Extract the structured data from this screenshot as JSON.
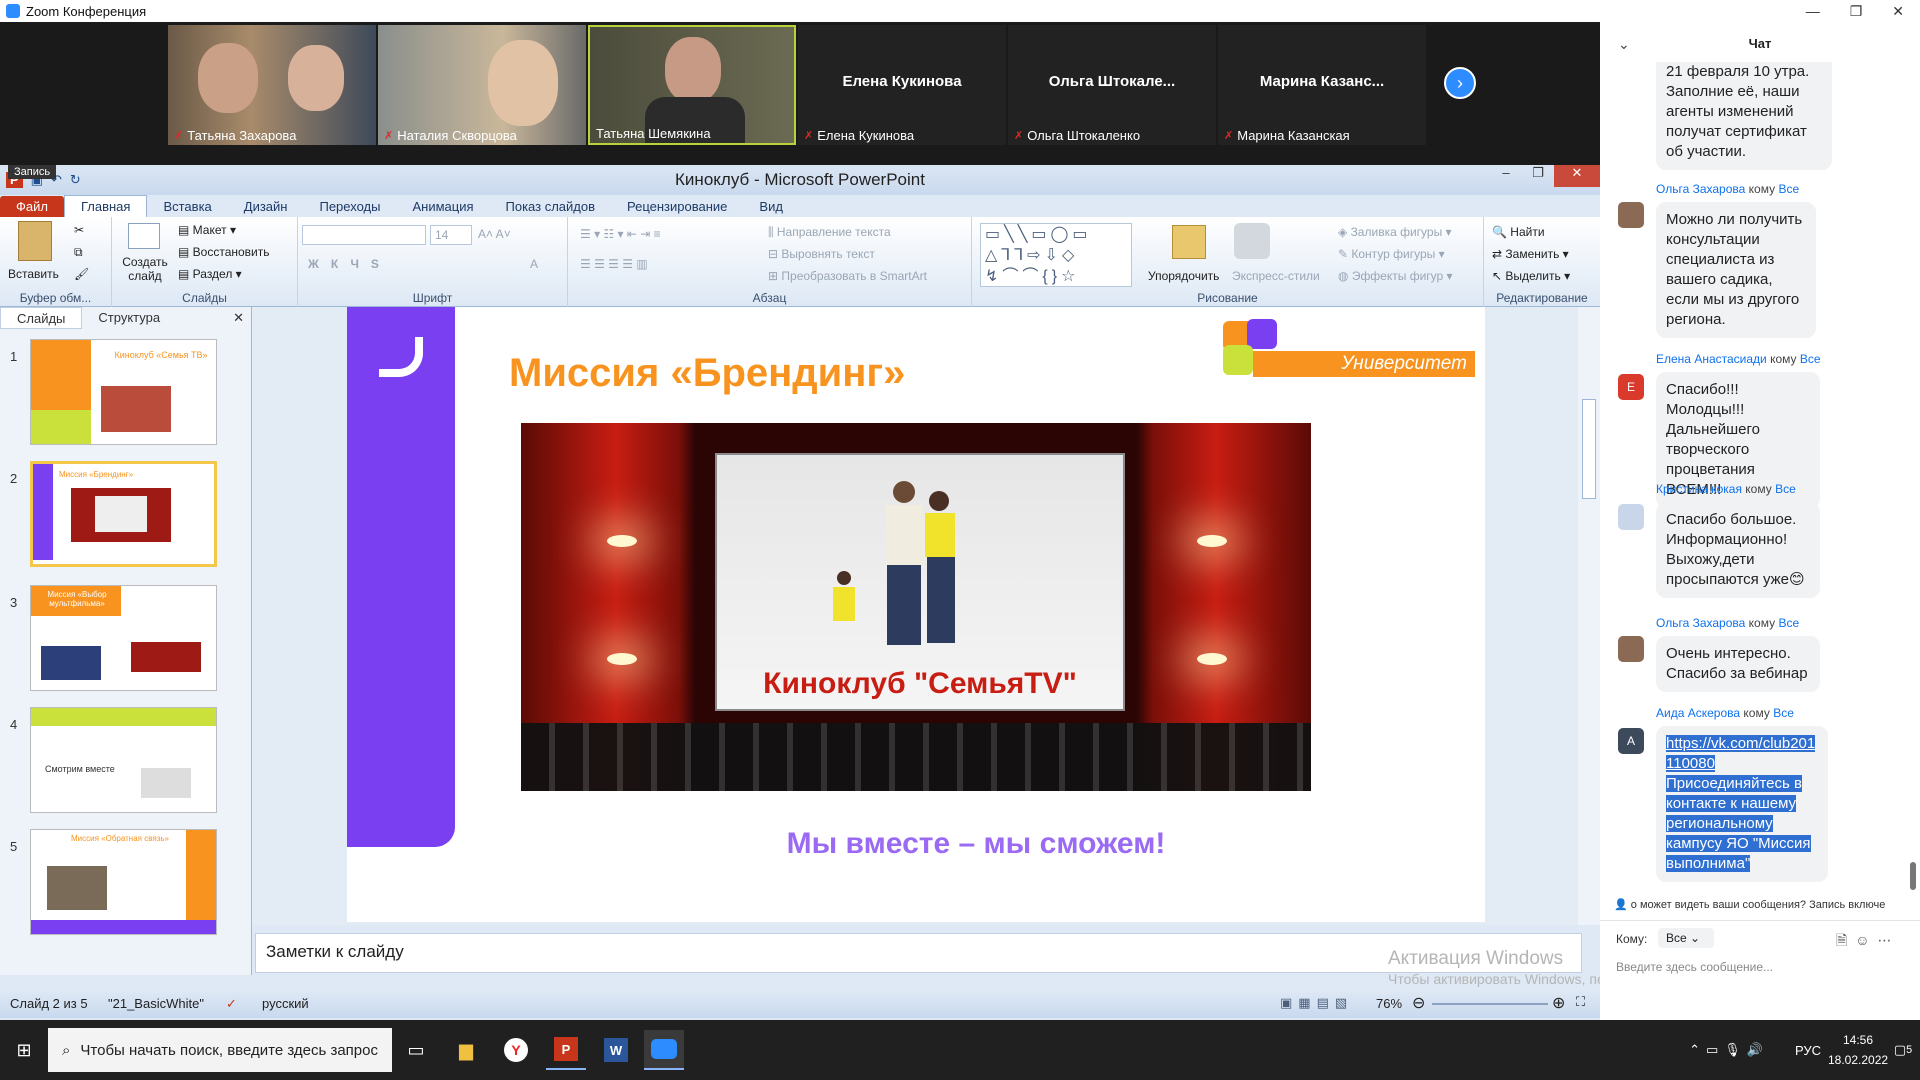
{
  "zoom": {
    "window_title": "Zoom Конференция",
    "win_min": "—",
    "win_max": "❐",
    "win_close": "✕",
    "participants": [
      {
        "name": "Татьяна Захарова",
        "video": true
      },
      {
        "name": "Наталия Скворцова",
        "video": true
      },
      {
        "name": "Татьяна Шемякина",
        "video": true
      },
      {
        "name": "Елена Кукинова",
        "big": "Елена Кукинова",
        "video": false
      },
      {
        "name": "Ольга Штокаленко",
        "big": "Ольга  Штокале...",
        "video": false
      },
      {
        "name": "Марина Казанская",
        "big": "Марина  Казанс...",
        "video": false
      }
    ],
    "next_arrow": "›",
    "recording_label": "Запись"
  },
  "ppt": {
    "title": "Киноклуб  -  Microsoft PowerPoint",
    "tabs": [
      "Файл",
      "Главная",
      "Вставка",
      "Дизайн",
      "Переходы",
      "Анимация",
      "Показ слайдов",
      "Рецензирование",
      "Вид"
    ],
    "ribbon": {
      "paste": "Вставить",
      "create_slide": "Создать слайд",
      "layout": "Макет",
      "restore": "Восстановить",
      "section": "Раздел",
      "font_size": "14",
      "text_direction": "Направление текста",
      "align_text": "Выровнять текст",
      "smartart": "Преобразовать в SmartArt",
      "arrange": "Упорядочить",
      "express_styles": "Экспресс-стили",
      "shape_fill": "Заливка фигуры",
      "shape_outline": "Контур фигуры",
      "shape_effects": "Эффекты фигур",
      "find": "Найти",
      "replace": "Заменить",
      "select": "Выделить",
      "groups": [
        "Буфер обм...",
        "Слайды",
        "Шрифт",
        "Абзац",
        "Рисование",
        "Редактирование"
      ]
    },
    "pane_tabs": [
      "Слайды",
      "Структура"
    ],
    "thumbs": [
      {
        "n": "1",
        "title": "Киноклуб «Семья ТВ»"
      },
      {
        "n": "2",
        "title": "Миссия «Брендинг»"
      },
      {
        "n": "3",
        "title": "Миссия «Выбор мультфильма»"
      },
      {
        "n": "4",
        "title": "Смотрим вместе"
      },
      {
        "n": "5",
        "title": "Миссия «Обратная связь»"
      }
    ],
    "slide": {
      "title": "Миссия «Брендинг»",
      "brand": "Университет Детства",
      "club": "Киноклуб \"СемьяTV\"",
      "slogan": "Мы вместе – мы сможем!"
    },
    "notes_placeholder": "Заметки к слайду",
    "activation_title": "Активация Windows",
    "activation_text": "Чтобы активировать Windows, перейдите в раздел \"Параметры\".",
    "status": {
      "slide_of": "Слайд 2 из 5",
      "theme": "\"21_BasicWhite\"",
      "language": "русский",
      "zoom": "76%"
    }
  },
  "chat": {
    "title": "Чат",
    "top_bubble": "21 февраля 10 утра. Заполние её, наши агенты изменений получат сертификат об участии.",
    "messages": [
      {
        "sender": "Ольга Захарова",
        "to": "кому",
        "target": "Все",
        "text": "Можно ли получить консультации специалиста из вашего садика, если мы из другого региона.",
        "avatar": "",
        "avatar_color": "#8a6a55"
      },
      {
        "sender": "Елена Анастасиади",
        "to": "кому",
        "target": "Все",
        "text": "Спасибо!!! Молодцы!!! Дальнейшего творческого процветания ВСЕМ!!!",
        "avatar": "Е",
        "avatar_color": "#d93a2b"
      },
      {
        "sender": "Кристина кокая",
        "to": "кому",
        "target": "Все",
        "text": "Спасибо большое. Информационно! Выхожу,дети просыпаются уже😊",
        "avatar": "",
        "avatar_color": "#c9d6ea"
      },
      {
        "sender": "Ольга Захарова",
        "to": "кому",
        "target": "Все",
        "text": "Очень интересно. Спасибо за вебинар",
        "avatar": "",
        "avatar_color": "#8a6a55"
      },
      {
        "sender": "Аида Аскерова",
        "to": "кому",
        "target": "Все",
        "link": "https://vk.com/club201110080",
        "text": "Присоединяйтесь в контакте к нашему региональному кампусу ЯО \"Миссия выполнима\"",
        "avatar": "А",
        "avatar_color": "#3c4a5c"
      }
    ],
    "notice": "о может видеть ваши сообщения? Запись включе",
    "to_label": "Кому:",
    "to_value": "Все",
    "input_placeholder": "Введите здесь сообщение..."
  },
  "taskbar": {
    "search_placeholder": "Чтобы начать поиск, введите здесь запрос",
    "lang": "РУС",
    "time": "14:56",
    "date": "18.02.2022",
    "notifications": "5"
  }
}
